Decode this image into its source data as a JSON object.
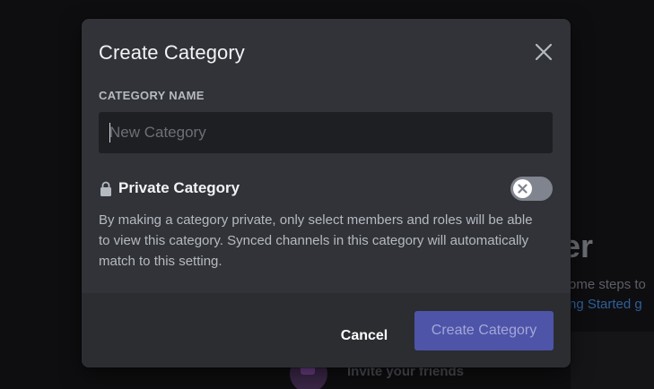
{
  "background": {
    "heading_fragment": "er",
    "subtext_fragment": "ome steps to",
    "link_fragment": "ng Started g",
    "invite_label": "Invite your friends"
  },
  "modal": {
    "title": "Create Category",
    "close_icon": "close-icon",
    "name_field": {
      "label": "CATEGORY NAME",
      "placeholder": "New Category",
      "value": ""
    },
    "private": {
      "icon": "lock-icon",
      "label": "Private Category",
      "enabled": false,
      "description": "By making a category private, only select members and roles will be able to view this category. Synced channels in this category will automatically match to this setting."
    },
    "footer": {
      "cancel_label": "Cancel",
      "create_label": "Create Category"
    }
  },
  "colors": {
    "modal_bg": "#313338",
    "footer_bg": "#2b2d31",
    "input_bg": "#1e1f22",
    "primary_disabled": "#4e54a8",
    "toggle_off": "#80848e"
  }
}
